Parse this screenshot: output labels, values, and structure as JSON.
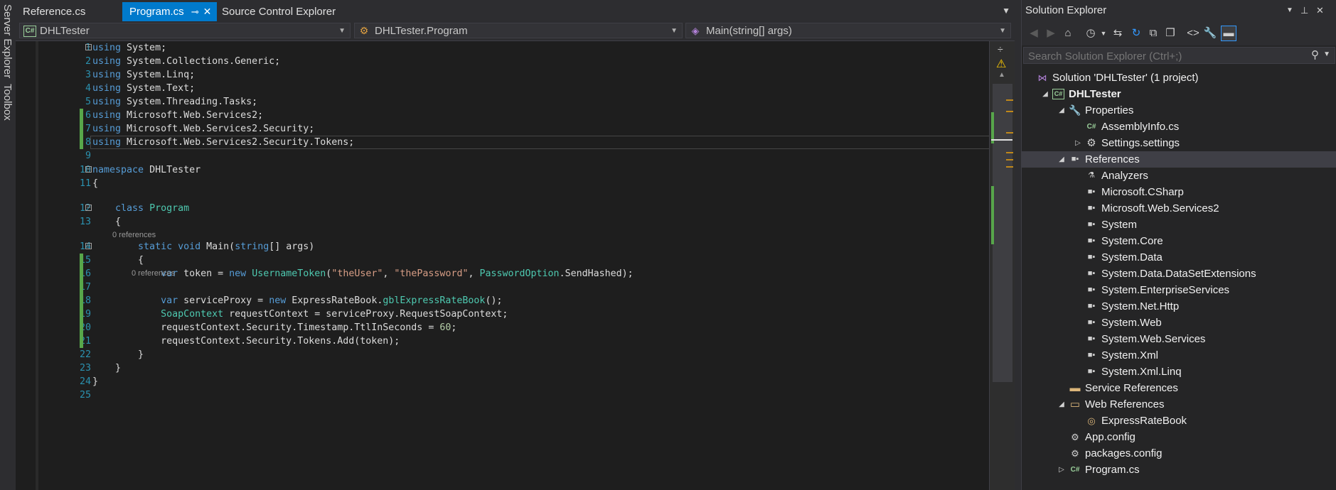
{
  "side_tabs": {
    "server_explorer": "Server Explorer",
    "toolbox": "Toolbox"
  },
  "tabs": {
    "reference": "Reference.cs",
    "program": "Program.cs",
    "source_control": "Source Control Explorer"
  },
  "nav": {
    "project": "DHLTester",
    "class": "DHLTester.Program",
    "member": "Main(string[] args)"
  },
  "code": {
    "lines": [
      [
        {
          "t": "using",
          "c": "kw"
        },
        {
          "t": " System;"
        }
      ],
      [
        {
          "t": "using",
          "c": "kw"
        },
        {
          "t": " System.Collections.Generic;"
        }
      ],
      [
        {
          "t": "using",
          "c": "kw"
        },
        {
          "t": " System.Linq;"
        }
      ],
      [
        {
          "t": "using",
          "c": "kw"
        },
        {
          "t": " System.Text;"
        }
      ],
      [
        {
          "t": "using",
          "c": "kw"
        },
        {
          "t": " System.Threading.Tasks;"
        }
      ],
      [
        {
          "t": "using",
          "c": "kw"
        },
        {
          "t": " Microsoft.Web.Services2;"
        }
      ],
      [
        {
          "t": "using",
          "c": "kw"
        },
        {
          "t": " Microsoft.Web.Services2.Security;"
        }
      ],
      [
        {
          "t": "using",
          "c": "kw"
        },
        {
          "t": " Microsoft.Web.Services2.Security.Tokens;"
        }
      ],
      [],
      [
        {
          "t": "namespace",
          "c": "kw"
        },
        {
          "t": " DHLTester"
        }
      ],
      [
        {
          "t": "{"
        }
      ],
      [
        {
          "t": "    "
        },
        {
          "t": "class",
          "c": "kw"
        },
        {
          "t": " "
        },
        {
          "t": "Program",
          "c": "ty"
        }
      ],
      [
        {
          "t": "    {"
        }
      ],
      [
        {
          "t": "        "
        },
        {
          "t": "static",
          "c": "kw"
        },
        {
          "t": " "
        },
        {
          "t": "void",
          "c": "kw"
        },
        {
          "t": " Main("
        },
        {
          "t": "string",
          "c": "kw"
        },
        {
          "t": "[] args)"
        }
      ],
      [
        {
          "t": "        {"
        }
      ],
      [
        {
          "t": "            "
        },
        {
          "t": "var",
          "c": "kw"
        },
        {
          "t": " token = "
        },
        {
          "t": "new",
          "c": "kw"
        },
        {
          "t": " "
        },
        {
          "t": "UsernameToken",
          "c": "ty"
        },
        {
          "t": "("
        },
        {
          "t": "\"theUser\"",
          "c": "str"
        },
        {
          "t": ", "
        },
        {
          "t": "\"thePassword\"",
          "c": "str"
        },
        {
          "t": ", "
        },
        {
          "t": "PasswordOption",
          "c": "ty"
        },
        {
          "t": ".SendHashed);"
        }
      ],
      [],
      [
        {
          "t": "            "
        },
        {
          "t": "var",
          "c": "kw"
        },
        {
          "t": " serviceProxy = "
        },
        {
          "t": "new",
          "c": "kw"
        },
        {
          "t": " ExpressRateBook."
        },
        {
          "t": "gblExpressRateBook",
          "c": "ty"
        },
        {
          "t": "();"
        }
      ],
      [
        {
          "t": "            "
        },
        {
          "t": "SoapContext",
          "c": "ty"
        },
        {
          "t": " requestContext = serviceProxy.RequestSoapContext;"
        }
      ],
      [
        {
          "t": "            requestContext.Security.Timestamp.TtlInSeconds = "
        },
        {
          "t": "60",
          "c": "num"
        },
        {
          "t": ";"
        }
      ],
      [
        {
          "t": "            requestContext.Security.Tokens.Add(token);"
        }
      ],
      [
        {
          "t": "        }"
        }
      ],
      [
        {
          "t": "    }"
        }
      ],
      [
        {
          "t": "}"
        }
      ],
      []
    ],
    "codelens_class": "0 references",
    "codelens_main": "0 references"
  },
  "solution_explorer": {
    "title": "Solution Explorer",
    "search_placeholder": "Search Solution Explorer (Ctrl+;)",
    "tree": [
      {
        "label": "Solution 'DHLTester' (1 project)",
        "icon": "solution-icon",
        "level": 0,
        "expander": ""
      },
      {
        "label": "DHLTester",
        "icon": "csharp-project-icon",
        "level": 1,
        "expander": "expanded",
        "bold": true
      },
      {
        "label": "Properties",
        "icon": "wrench-icon",
        "level": 2,
        "expander": "expanded"
      },
      {
        "label": "AssemblyInfo.cs",
        "icon": "csharp-file-icon",
        "level": 3,
        "expander": ""
      },
      {
        "label": "Settings.settings",
        "icon": "gear-icon",
        "level": 3,
        "expander": "collapsed"
      },
      {
        "label": "References",
        "icon": "reference-icon",
        "level": 2,
        "expander": "expanded",
        "selected": true
      },
      {
        "label": "Analyzers",
        "icon": "analyzer-icon",
        "level": 3,
        "expander": ""
      },
      {
        "label": "Microsoft.CSharp",
        "icon": "reference-icon",
        "level": 3,
        "expander": ""
      },
      {
        "label": "Microsoft.Web.Services2",
        "icon": "reference-icon",
        "level": 3,
        "expander": ""
      },
      {
        "label": "System",
        "icon": "reference-icon",
        "level": 3,
        "expander": ""
      },
      {
        "label": "System.Core",
        "icon": "reference-icon",
        "level": 3,
        "expander": ""
      },
      {
        "label": "System.Data",
        "icon": "reference-icon",
        "level": 3,
        "expander": ""
      },
      {
        "label": "System.Data.DataSetExtensions",
        "icon": "reference-icon",
        "level": 3,
        "expander": ""
      },
      {
        "label": "System.EnterpriseServices",
        "icon": "reference-icon",
        "level": 3,
        "expander": ""
      },
      {
        "label": "System.Net.Http",
        "icon": "reference-icon",
        "level": 3,
        "expander": ""
      },
      {
        "label": "System.Web",
        "icon": "reference-icon",
        "level": 3,
        "expander": ""
      },
      {
        "label": "System.Web.Services",
        "icon": "reference-icon",
        "level": 3,
        "expander": ""
      },
      {
        "label": "System.Xml",
        "icon": "reference-icon",
        "level": 3,
        "expander": ""
      },
      {
        "label": "System.Xml.Linq",
        "icon": "reference-icon",
        "level": 3,
        "expander": ""
      },
      {
        "label": "Service References",
        "icon": "folder-icon",
        "level": 2,
        "expander": ""
      },
      {
        "label": "Web References",
        "icon": "folder-open-icon",
        "level": 2,
        "expander": "expanded"
      },
      {
        "label": "ExpressRateBook",
        "icon": "web-reference-icon",
        "level": 3,
        "expander": ""
      },
      {
        "label": "App.config",
        "icon": "config-icon",
        "level": 2,
        "expander": ""
      },
      {
        "label": "packages.config",
        "icon": "config-icon",
        "level": 2,
        "expander": ""
      },
      {
        "label": "Program.cs",
        "icon": "csharp-file-icon",
        "level": 2,
        "expander": "collapsed"
      }
    ]
  },
  "colors": {
    "accent": "#007acc",
    "keyword": "#569cd6",
    "type": "#4ec9b0",
    "string": "#d69d85",
    "number": "#b5cea8",
    "line_number": "#2b91af",
    "change_bar": "#57a64a"
  }
}
